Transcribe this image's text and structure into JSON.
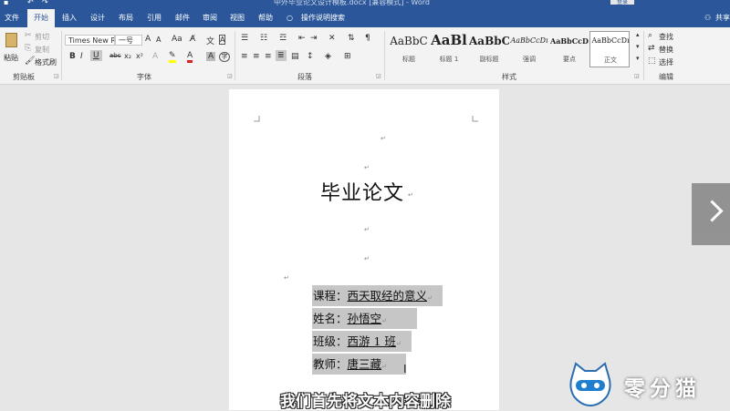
{
  "window": {
    "title": "中外毕业论文设计模板.docx [兼容模式] - Word",
    "login_label": "登录",
    "quick_access": [
      "save-icon",
      "undo-icon",
      "redo-icon"
    ]
  },
  "tabs": [
    {
      "label": "文件"
    },
    {
      "label": "开始"
    },
    {
      "label": "插入"
    },
    {
      "label": "设计"
    },
    {
      "label": "布局"
    },
    {
      "label": "引用"
    },
    {
      "label": "邮件"
    },
    {
      "label": "审阅"
    },
    {
      "label": "视图"
    },
    {
      "label": "帮助"
    }
  ],
  "tell_me": "操作说明搜索",
  "share": "共享",
  "clipboard": {
    "paste": "粘贴",
    "cut": "剪切",
    "copy": "复制",
    "format_painter": "格式刷",
    "label": "剪贴板"
  },
  "font": {
    "name": "Times New R",
    "size": "一号",
    "label": "字体",
    "buttons": [
      "B",
      "I",
      "U",
      "abc",
      "x₂",
      "x²"
    ]
  },
  "paragraph": {
    "label": "段落"
  },
  "styles": {
    "label": "样式",
    "items": [
      {
        "sample": "AaBbC",
        "name": "标题"
      },
      {
        "sample": "AaBl",
        "name": "标题 1"
      },
      {
        "sample": "AaBbC",
        "name": "副标题"
      },
      {
        "sample": "AaBbCcDı",
        "name": "强调"
      },
      {
        "sample": "AaBbCcD",
        "name": "要点"
      },
      {
        "sample": "AaBbCcDı",
        "name": "正文"
      }
    ]
  },
  "editing": {
    "find": "查找",
    "replace": "替换",
    "select": "选择",
    "label": "编辑"
  },
  "document": {
    "title": "毕业论文",
    "paragraph_mark": "↵",
    "rows": [
      {
        "label": "课程：",
        "value": "西天取经的意义"
      },
      {
        "label": "姓名：",
        "value": "孙悟空"
      },
      {
        "label": "班级：",
        "value": "西游 1 班"
      },
      {
        "label": "教师：",
        "value": "唐三藏"
      }
    ]
  },
  "overlay": {
    "subtitle": "我们首先将文本内容删除",
    "logo_text": "零分猫",
    "next_icon": "chevron-right-icon"
  },
  "colors": {
    "ribbon_blue": "#2b579a",
    "selection": "#c6c6c6",
    "highlight_yellow": "#ffff00",
    "font_red": "#e02020"
  }
}
